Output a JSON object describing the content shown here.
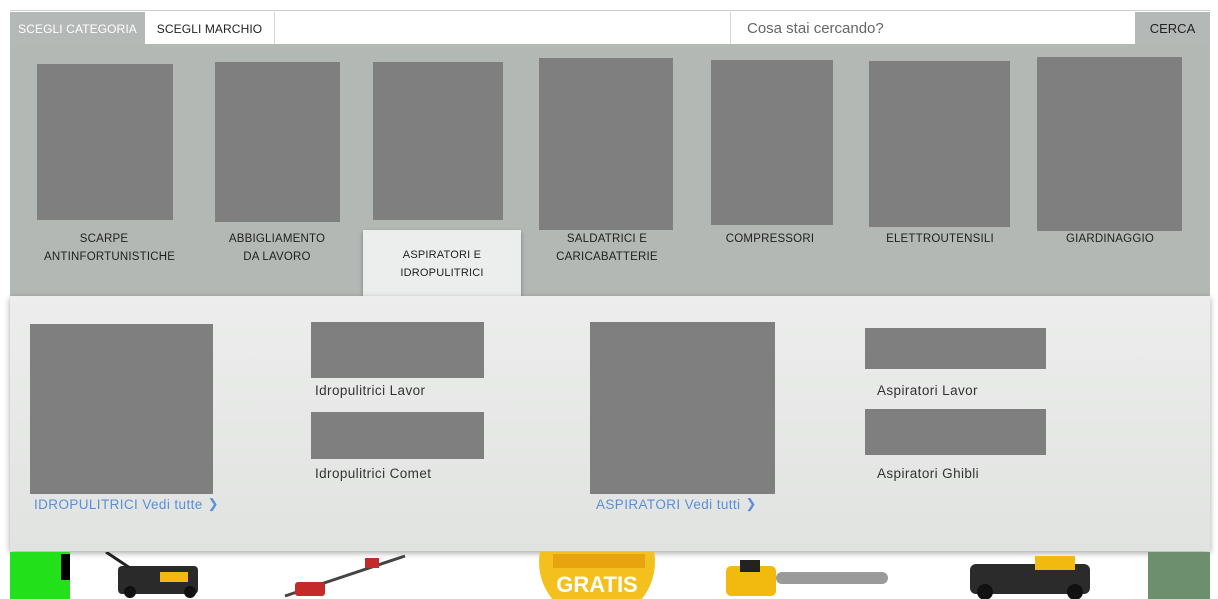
{
  "header": {
    "tabs": [
      {
        "label": "SCEGLI CATEGORIA",
        "active": true
      },
      {
        "label": "SCEGLI MARCHIO",
        "active": false
      }
    ],
    "search": {
      "placeholder": "Cosa stai cercando?",
      "button_label": "CERCA"
    }
  },
  "categories": [
    {
      "label": "SCARPE ANTINFORTUNISTICHE"
    },
    {
      "label": "ABBIGLIAMENTO DA LAVORO"
    },
    {
      "label": "ASPIRATORI E IDROPULITRICI",
      "selected": true
    },
    {
      "label": "SALDATRICI E CARICABATTERIE"
    },
    {
      "label": "COMPRESSORI"
    },
    {
      "label": "ELETTROUTENSILI"
    },
    {
      "label": "GIARDINAGGIO"
    }
  ],
  "submenu": {
    "idropulitrici": {
      "see_all": "IDROPULITRICI Vedi tutte",
      "items": [
        "Idropulitrici Lavor",
        "Idropulitrici Comet"
      ]
    },
    "aspiratori": {
      "see_all": "ASPIRATORI Vedi tutti",
      "items": [
        "Aspiratori Lavor",
        "Aspiratori Ghibli"
      ]
    }
  },
  "banner": {
    "badge_text": "GRATIS"
  },
  "colors": {
    "accent_link": "#5a8fd8",
    "panel_gray": "#b3b8b5",
    "placeholder_gray": "#7f7f7f"
  }
}
